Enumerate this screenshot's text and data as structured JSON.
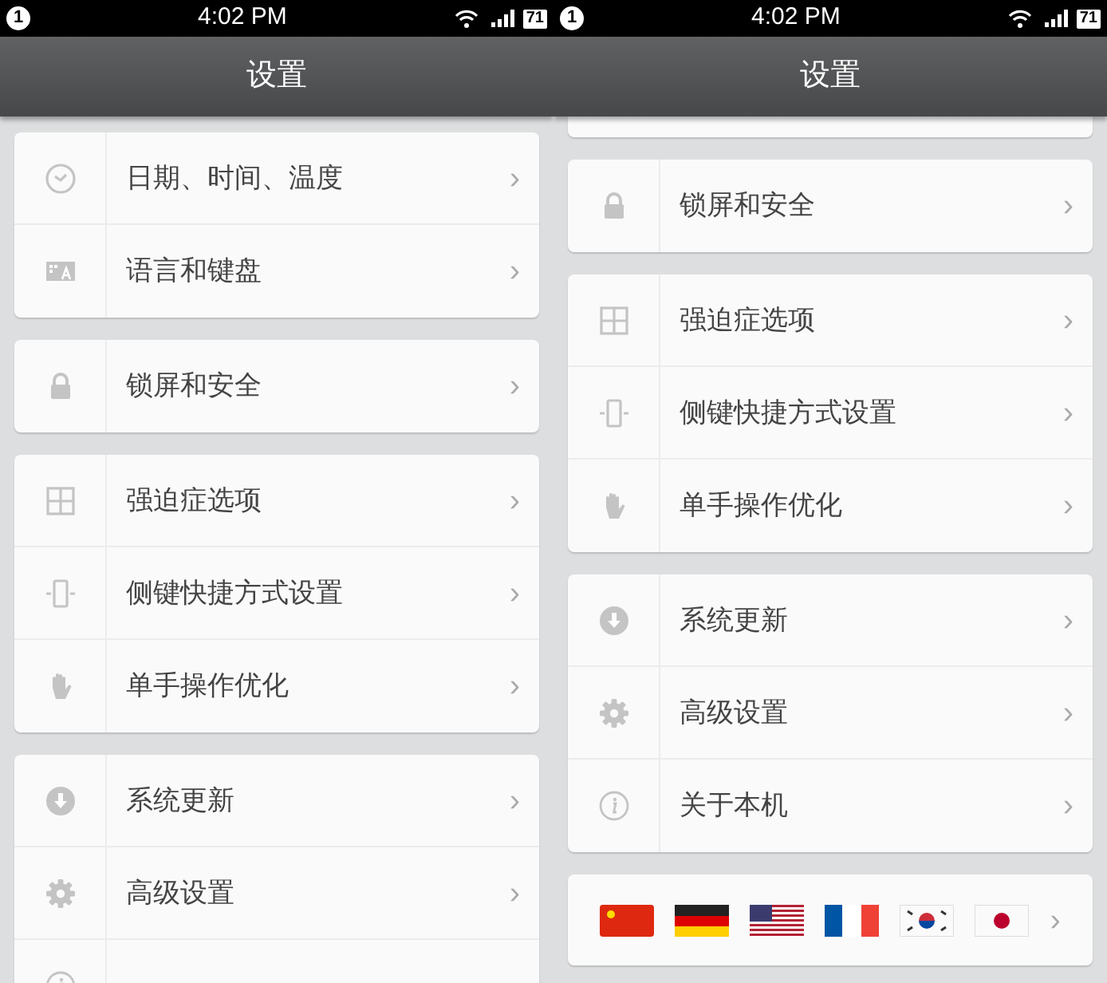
{
  "panels": [
    {
      "status_bar": {
        "notification": "1",
        "time": "4:02 PM",
        "battery": "71"
      },
      "title": "设置",
      "scrolled": false,
      "groups": [
        {
          "items": [
            {
              "kind": "clock",
              "label": "日期、时间、温度",
              "chevron": "›"
            },
            {
              "kind": "keyboard",
              "label": "语言和键盘",
              "chevron": "›"
            }
          ]
        },
        {
          "items": [
            {
              "kind": "lock",
              "label": "锁屏和安全",
              "chevron": "›"
            }
          ]
        },
        {
          "items": [
            {
              "kind": "grid",
              "label": "强迫症选项",
              "chevron": "›"
            },
            {
              "kind": "phone",
              "label": "侧键快捷方式设置",
              "chevron": "›"
            },
            {
              "kind": "hand",
              "label": "单手操作优化",
              "chevron": "›"
            }
          ]
        },
        {
          "items": [
            {
              "kind": "download",
              "label": "系统更新",
              "chevron": "›"
            },
            {
              "kind": "gear",
              "label": "高级设置",
              "chevron": "›"
            },
            {
              "kind": "info"
            }
          ]
        }
      ]
    },
    {
      "status_bar": {
        "notification": "1",
        "time": "4:02 PM",
        "battery": "71"
      },
      "title": "设置",
      "scrolled": true,
      "groups": [
        {
          "items": [
            {
              "kind": "lock",
              "label": "锁屏和安全",
              "chevron": "›"
            }
          ]
        },
        {
          "items": [
            {
              "kind": "grid",
              "label": "强迫症选项",
              "chevron": "›"
            },
            {
              "kind": "phone",
              "label": "侧键快捷方式设置",
              "chevron": "›"
            },
            {
              "kind": "hand",
              "label": "单手操作优化",
              "chevron": "›"
            }
          ]
        },
        {
          "items": [
            {
              "kind": "download",
              "label": "系统更新",
              "chevron": "›"
            },
            {
              "kind": "gear",
              "label": "高级设置",
              "chevron": "›"
            },
            {
              "kind": "info",
              "label": "关于本机",
              "chevron": "›"
            }
          ]
        },
        {
          "kind": "flags",
          "chevron": "›"
        }
      ]
    }
  ]
}
